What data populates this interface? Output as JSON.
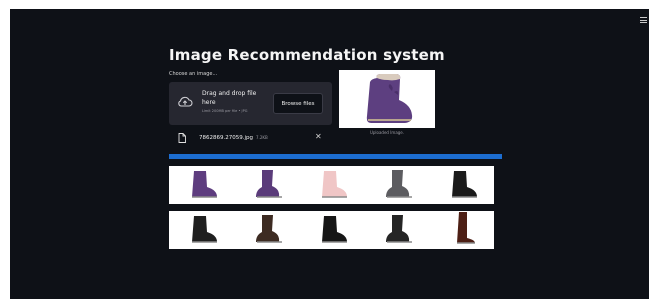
{
  "app": {
    "title": "Image Recommendation system",
    "menu_icon": "hamburger-menu-icon"
  },
  "uploader": {
    "label": "Choose an image...",
    "drop_text": "Drag and drop file here",
    "limit_text": "Limit 200MB per file • JPG",
    "browse_label": "Browse files",
    "upload_icon": "cloud-upload-icon"
  },
  "file": {
    "name": "7862869.27059.jpg",
    "size": "7.2KB",
    "file_icon": "file-icon",
    "close_icon": "close-icon"
  },
  "uploaded": {
    "caption": "Uploaded Image."
  },
  "progress": {
    "value": 1.0,
    "color": "#1c6dd0"
  },
  "recommendations": {
    "row1": [
      {
        "name": "purple-boot",
        "color": "#5e3d7f"
      },
      {
        "name": "purple-bow-boot",
        "color": "#5a3b7a"
      },
      {
        "name": "pink-boot",
        "color": "#f0c6c6"
      },
      {
        "name": "grey-boot",
        "color": "#5c5c60"
      },
      {
        "name": "black-boot",
        "color": "#1b1b1b"
      }
    ],
    "row2": [
      {
        "name": "black-buckle-boot",
        "color": "#1f1f1f"
      },
      {
        "name": "dark-brown-boot",
        "color": "#3d2b22"
      },
      {
        "name": "black-bow-boot",
        "color": "#161616"
      },
      {
        "name": "black-strap-boot",
        "color": "#252525"
      },
      {
        "name": "brown-tall-boot",
        "color": "#4d1f15"
      }
    ]
  }
}
